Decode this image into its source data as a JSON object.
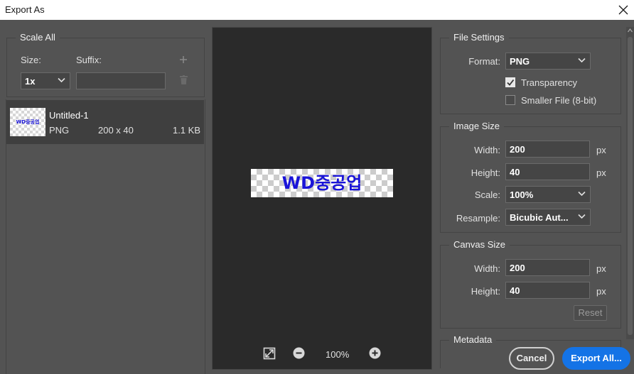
{
  "window": {
    "title": "Export As"
  },
  "scale_all": {
    "legend": "Scale All",
    "size_label": "Size:",
    "suffix_label": "Suffix:",
    "size_value": "1x",
    "suffix_value": ""
  },
  "asset": {
    "name": "Untitled-1",
    "format": "PNG",
    "dimensions": "200 x 40",
    "filesize": "1.1 KB",
    "thumb_text": "WD중공업"
  },
  "preview": {
    "image_text": "WD중공업",
    "zoom": "100%"
  },
  "file_settings": {
    "legend": "File Settings",
    "format_label": "Format:",
    "format_value": "PNG",
    "transparency_label": "Transparency",
    "transparency_checked": true,
    "smaller_file_label": "Smaller File (8-bit)",
    "smaller_file_checked": false
  },
  "image_size": {
    "legend": "Image Size",
    "width_label": "Width:",
    "width_value": "200",
    "height_label": "Height:",
    "height_value": "40",
    "unit": "px",
    "scale_label": "Scale:",
    "scale_value": "100%",
    "resample_label": "Resample:",
    "resample_value": "Bicubic Aut..."
  },
  "canvas_size": {
    "legend": "Canvas Size",
    "width_label": "Width:",
    "width_value": "200",
    "height_label": "Height:",
    "height_value": "40",
    "unit": "px",
    "reset_label": "Reset"
  },
  "metadata": {
    "legend": "Metadata"
  },
  "footer": {
    "cancel_label": "Cancel",
    "export_label": "Export All..."
  },
  "colors": {
    "accent": "#1473e6",
    "panel_bg": "#535353",
    "preview_bg": "#2a2a2a",
    "preview_text": "#1a14d8"
  }
}
